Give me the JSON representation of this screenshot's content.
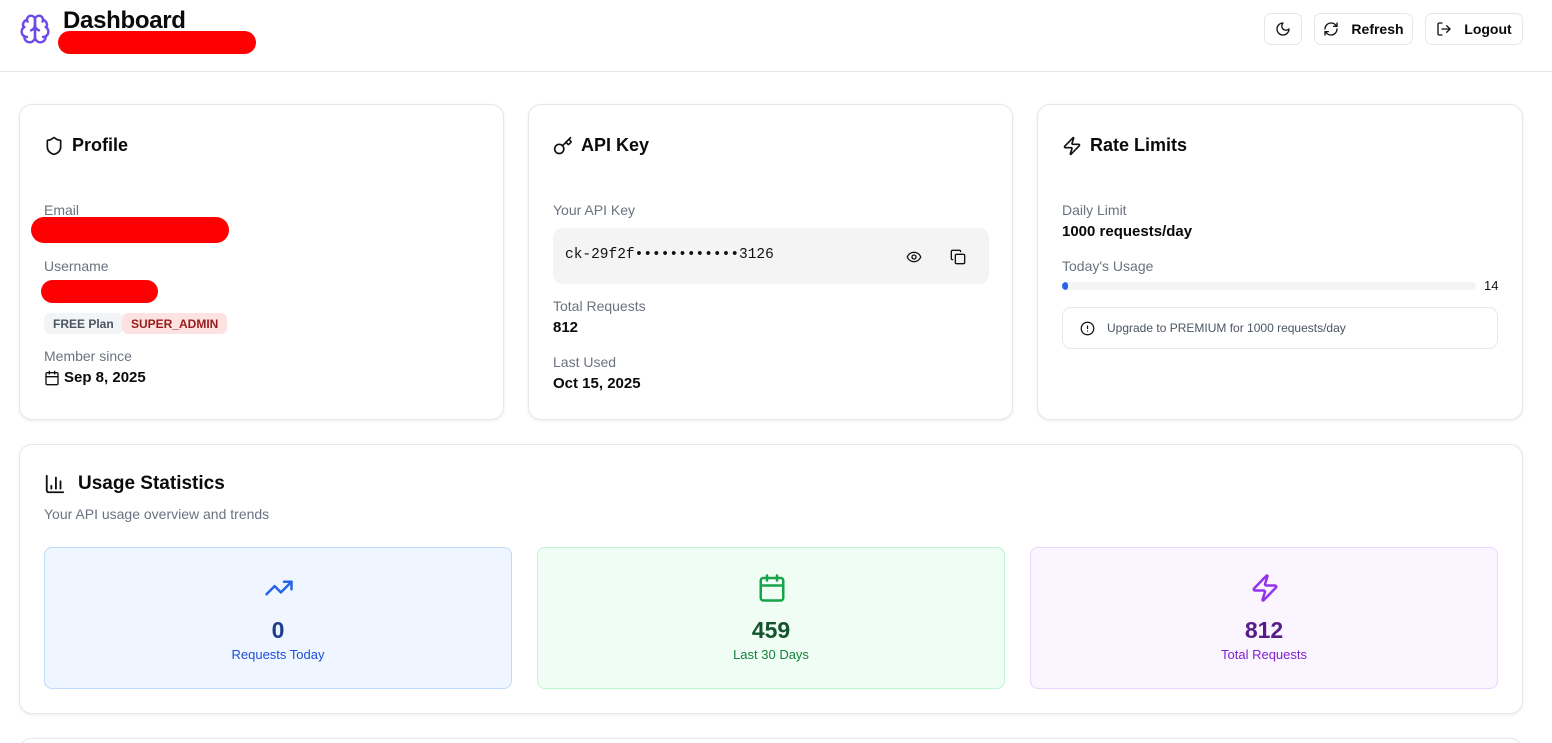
{
  "header": {
    "title": "Dashboard",
    "refresh_label": "Refresh",
    "logout_label": "Logout"
  },
  "profile": {
    "title": "Profile",
    "email_label": "Email",
    "username_label": "Username",
    "plan_badge": "FREE Plan",
    "role_badge": "SUPER_ADMIN",
    "member_since_label": "Member since",
    "member_since_value": "Sep 8, 2025"
  },
  "api_key": {
    "title": "API Key",
    "your_key_label": "Your API Key",
    "masked_key": "ck-29f2f••••••••••••3126",
    "total_requests_label": "Total Requests",
    "total_requests_value": "812",
    "last_used_label": "Last Used",
    "last_used_value": "Oct 15, 2025"
  },
  "rate_limits": {
    "title": "Rate Limits",
    "daily_limit_label": "Daily Limit",
    "daily_limit_value": "1000 requests/day",
    "todays_usage_label": "Today's Usage",
    "todays_usage_value": "14",
    "usage_fraction": 0.014,
    "upgrade_notice": "Upgrade to PREMIUM for 1000 requests/day"
  },
  "usage_stats": {
    "title": "Usage Statistics",
    "subtitle": "Your API usage overview and trends",
    "tiles": [
      {
        "value": "0",
        "label": "Requests Today",
        "icon": "trending-up-icon"
      },
      {
        "value": "459",
        "label": "Last 30 Days",
        "icon": "calendar-icon"
      },
      {
        "value": "812",
        "label": "Total Requests",
        "icon": "zap-icon"
      }
    ]
  },
  "colors": {
    "brand": "#6d4be8",
    "progress": "#2563eb",
    "blue_tile_bg": "#eff6ff",
    "green_tile_bg": "#f0fdf4",
    "purple_tile_bg": "#faf5ff"
  }
}
